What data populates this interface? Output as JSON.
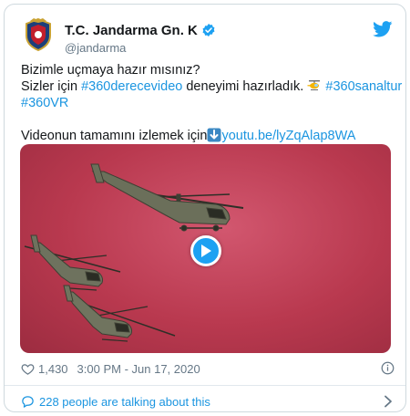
{
  "account": {
    "name": "T.C. Jandarma Gn. K",
    "handle": "@jandarma",
    "verified_icon": "verified-badge-icon",
    "logo_icon": "jandarma-emblem-icon"
  },
  "brand": {
    "icon": "twitter-bird-icon",
    "color": "#1da1f2"
  },
  "tweet": {
    "line1": "Bizimle uçmaya hazır mısınız?",
    "line2_prefix": "Sizler için ",
    "hashtag_1": "#360derecevideo",
    "line2_mid": " deneyimi hazırladık.",
    "hashtag_2": "#360sanaltur",
    "hashtag_3": "#360VR",
    "line4_prefix": "Videonun tamamını izlemek için",
    "link": "youtu.be/lyZqAlap8WA",
    "link_color": "#1b95e0"
  },
  "media": {
    "type": "video",
    "play_icon": "play-icon",
    "background_color": "#b9394f"
  },
  "meta": {
    "likes": "1,430",
    "time": "3:00 PM - Jun 17, 2020",
    "heart_icon": "heart-icon",
    "info_icon": "info-icon"
  },
  "conversation": {
    "label": "228 people are talking about this",
    "chevron_icon": "chevron-right-icon"
  }
}
